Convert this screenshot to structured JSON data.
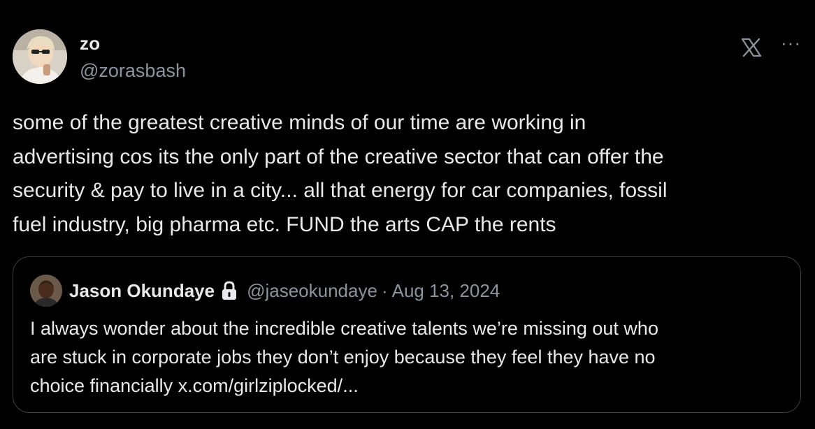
{
  "tweet": {
    "author": {
      "display_name": "zo",
      "handle": "@zorasbash",
      "avatar_icon": "user-avatar-photo"
    },
    "actions": {
      "logo_icon": "x-logo-icon",
      "more_label": "···"
    },
    "text": "some of the greatest creative minds of our time are working in\nadvertising cos its the only part of the creative sector that can offer the\nsecurity & pay to live in a city...  all that energy for car companies, fossil\nfuel industry, big pharma etc. FUND the arts CAP the rents",
    "quoted": {
      "display_name": "Jason Okundaye",
      "lock_icon": "lock-icon",
      "handle": "@jaseokundaye",
      "separator": "·",
      "date": "Aug 13, 2024",
      "text": "I always wonder about the incredible creative talents we’re missing out who\nare stuck in corporate jobs they don’t enjoy because they feel they have no\nchoice financially x.com/girlziplocked/..."
    }
  },
  "colors": {
    "background": "#000000",
    "primary_text": "#e7e9ea",
    "secondary_text": "#8b949e",
    "border": "#3a3f44"
  }
}
